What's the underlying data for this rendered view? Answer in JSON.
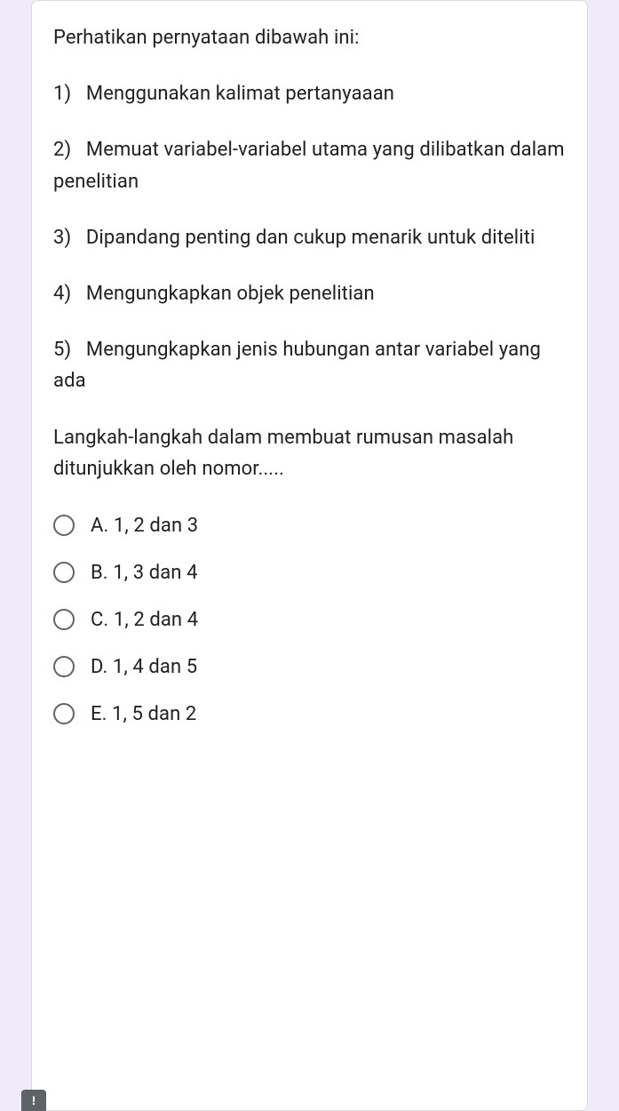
{
  "question": {
    "intro": "Perhatikan pernyataan dibawah ini:",
    "statements": [
      "1)   Menggunakan kalimat pertanyaaan",
      "2)   Memuat variabel-variabel utama yang dilibatkan dalam penelitian",
      "3)   Dipandang penting dan cukup menarik untuk diteliti",
      "4)   Mengungkapkan objek penelitian",
      "5)   Mengungkapkan jenis hubungan antar variabel yang ada"
    ],
    "prompt": "Langkah-langkah dalam membuat rumusan masalah ditunjukkan oleh nomor....."
  },
  "options": [
    {
      "label": "A. 1, 2 dan 3"
    },
    {
      "label": "B. 1, 3 dan 4"
    },
    {
      "label": "C. 1, 2 dan 4"
    },
    {
      "label": "D. 1, 4 dan 5"
    },
    {
      "label": "E. 1, 5 dan 2"
    }
  ],
  "report_icon": "!"
}
